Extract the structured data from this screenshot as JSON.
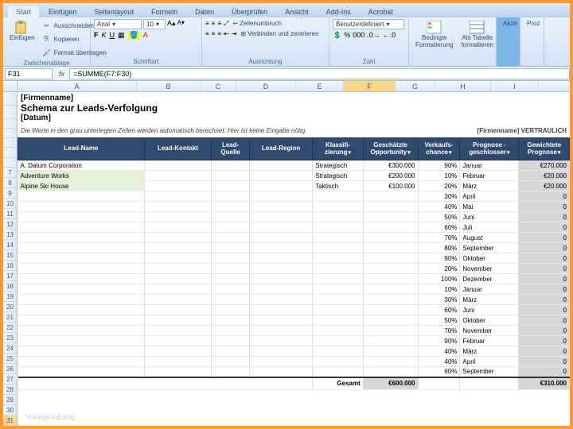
{
  "tabs": [
    "Start",
    "Einfügen",
    "Seitenlayout",
    "Formeln",
    "Daten",
    "Überprüfen",
    "Ansicht",
    "Add-Ins",
    "Acrobat"
  ],
  "active_tab": "Start",
  "ribbon": {
    "clipboard": {
      "cut": "Ausschneiden",
      "copy": "Kopieren",
      "format": "Format übertragen",
      "label": "Zwischenablage",
      "paste": "Einfügen"
    },
    "font": {
      "name": "Arial",
      "size": "10",
      "label": "Schriftart"
    },
    "align": {
      "wrap": "Zeilenumbruch",
      "merge": "Verbinden und zentrieren",
      "label": "Ausrichtung"
    },
    "number": {
      "format": "Benutzerdefiniert",
      "label": "Zahl"
    },
    "styles": {
      "cond": "Bedingte Formatierung",
      "table": "Als Tabelle formatieren",
      "label": ""
    },
    "cells": "Akze",
    "proz": "Proz"
  },
  "formula": {
    "name_box": "F31",
    "fx": "fx",
    "value": "=SUMME(F7:F30)"
  },
  "columns": [
    "A",
    "B",
    "C",
    "D",
    "E",
    "F",
    "G",
    "H",
    "I"
  ],
  "title": {
    "l1": "[Firmenname]",
    "l2": "Schema zur Leads-Verfolgung",
    "l3": "[Datum]"
  },
  "hint": "Die Werte in den grau unterlegten Zellen werden automatisch berechnet. Hier ist keine Eingabe nötig.",
  "hint_right": "[Firmenname]  VERTRAULICH",
  "headers": [
    "Lead-Name",
    "Lead-Kontakt",
    "Lead-Quelle",
    "Lead-Region",
    "Klassifi-zierung",
    "Geschätzte Opportunity",
    "Verkaufs-chance",
    "Prognose - geschlosser",
    "Gewichtete Prognose"
  ],
  "rows": [
    {
      "name": "A. Datum Corporation",
      "klass": "Strategisch",
      "opp": "€300.000",
      "chance": "90%",
      "monat": "Januar",
      "prog": "€270.000",
      "green": false
    },
    {
      "name": "Adventure Works",
      "klass": "Strategisch",
      "opp": "€200.000",
      "chance": "10%",
      "monat": "Februar",
      "prog": "€20.000",
      "green": true
    },
    {
      "name": "Alpine Ski House",
      "klass": "Taktisch",
      "opp": "€100.000",
      "chance": "20%",
      "monat": "März",
      "prog": "€20.000",
      "green": true
    },
    {
      "name": "",
      "klass": "",
      "opp": "",
      "chance": "30%",
      "monat": "April",
      "prog": "0",
      "green": false
    },
    {
      "name": "",
      "klass": "",
      "opp": "",
      "chance": "40%",
      "monat": "Mai",
      "prog": "0",
      "green": false
    },
    {
      "name": "",
      "klass": "",
      "opp": "",
      "chance": "50%",
      "monat": "Juni",
      "prog": "0",
      "green": false
    },
    {
      "name": "",
      "klass": "",
      "opp": "",
      "chance": "60%",
      "monat": "Juli",
      "prog": "0",
      "green": false
    },
    {
      "name": "",
      "klass": "",
      "opp": "",
      "chance": "70%",
      "monat": "August",
      "prog": "0",
      "green": false
    },
    {
      "name": "",
      "klass": "",
      "opp": "",
      "chance": "80%",
      "monat": "September",
      "prog": "0",
      "green": false
    },
    {
      "name": "",
      "klass": "",
      "opp": "",
      "chance": "90%",
      "monat": "Oktober",
      "prog": "0",
      "green": false
    },
    {
      "name": "",
      "klass": "",
      "opp": "",
      "chance": "20%",
      "monat": "November",
      "prog": "0",
      "green": false
    },
    {
      "name": "",
      "klass": "",
      "opp": "",
      "chance": "100%",
      "monat": "Dezember",
      "prog": "0",
      "green": false
    },
    {
      "name": "",
      "klass": "",
      "opp": "",
      "chance": "10%",
      "monat": "Januar",
      "prog": "0",
      "green": false
    },
    {
      "name": "",
      "klass": "",
      "opp": "",
      "chance": "30%",
      "monat": "März",
      "prog": "0",
      "green": false
    },
    {
      "name": "",
      "klass": "",
      "opp": "",
      "chance": "60%",
      "monat": "Juni",
      "prog": "0",
      "green": false
    },
    {
      "name": "",
      "klass": "",
      "opp": "",
      "chance": "50%",
      "monat": "Oktober",
      "prog": "0",
      "green": false
    },
    {
      "name": "",
      "klass": "",
      "opp": "",
      "chance": "70%",
      "monat": "November",
      "prog": "0",
      "green": false
    },
    {
      "name": "",
      "klass": "",
      "opp": "",
      "chance": "90%",
      "monat": "Februar",
      "prog": "0",
      "green": false
    },
    {
      "name": "",
      "klass": "",
      "opp": "",
      "chance": "40%",
      "monat": "März",
      "prog": "0",
      "green": false
    },
    {
      "name": "",
      "klass": "",
      "opp": "",
      "chance": "40%",
      "monat": "April",
      "prog": "0",
      "green": false
    },
    {
      "name": "",
      "klass": "",
      "opp": "",
      "chance": "60%",
      "monat": "September",
      "prog": "0",
      "green": false
    }
  ],
  "footer": {
    "label": "Gesamt",
    "opp": "€600.000",
    "prog": "€310.000"
  },
  "watermark": "Vorlage katalog"
}
